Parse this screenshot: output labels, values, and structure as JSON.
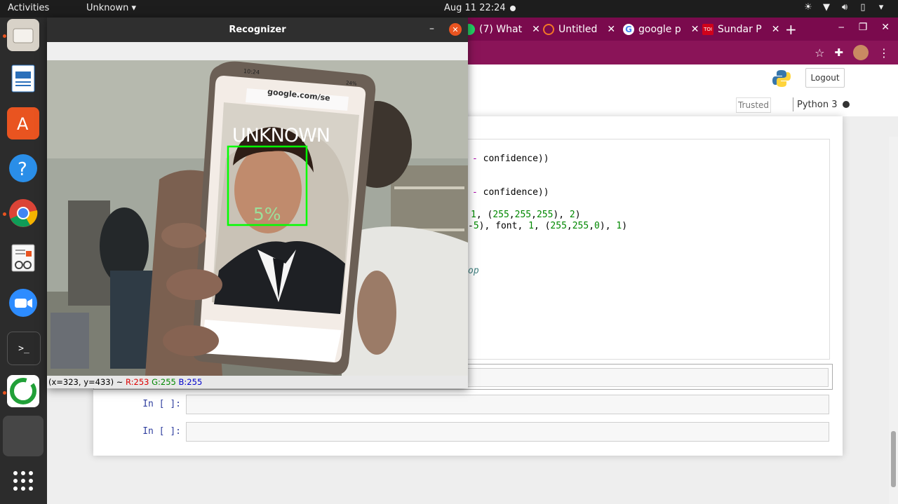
{
  "topbar": {
    "activities": "Activities",
    "app_menu": "Unknown",
    "clock": "Aug 11  22:24"
  },
  "browser": {
    "tabs": [
      {
        "label": "(7) What",
        "color": "#25d366"
      },
      {
        "label": "Untitled",
        "color": "#f37726"
      },
      {
        "label": "google p",
        "color": "#ffffff"
      },
      {
        "label": "Sundar P",
        "color": "#d0021b"
      }
    ]
  },
  "jupyter": {
    "logout_label": "Logout",
    "trusted_label": "Trusted",
    "kernel_label": "Python 3",
    "code_lines": [
      [
        "- ",
        "confidence))"
      ],
      [
        "- ",
        "confidence))"
      ],
      [
        "1, (255,255,255), 2)"
      ],
      [
        "-5), font, 1, (255,255,0), 1)"
      ]
    ],
    "comment_fragment": "op",
    "cells": [
      {
        "prompt": "In [ ]:"
      },
      {
        "prompt": "In [ ]:"
      }
    ]
  },
  "recognizer": {
    "title": "Recognizer",
    "overlay_label": "UNKNOWN",
    "confidence_text": "  5%",
    "phone": {
      "time": "10:24",
      "battery": "24%",
      "url": "google.com/se"
    },
    "status": {
      "coords": "(x=323, y=433) ~ ",
      "r": "R:253",
      "g": "G:255",
      "b": "B:255"
    }
  },
  "colors": {
    "ubuntu_orange": "#e95420",
    "tabbar": "#7a0a4d",
    "face_box": "#00ff00"
  }
}
